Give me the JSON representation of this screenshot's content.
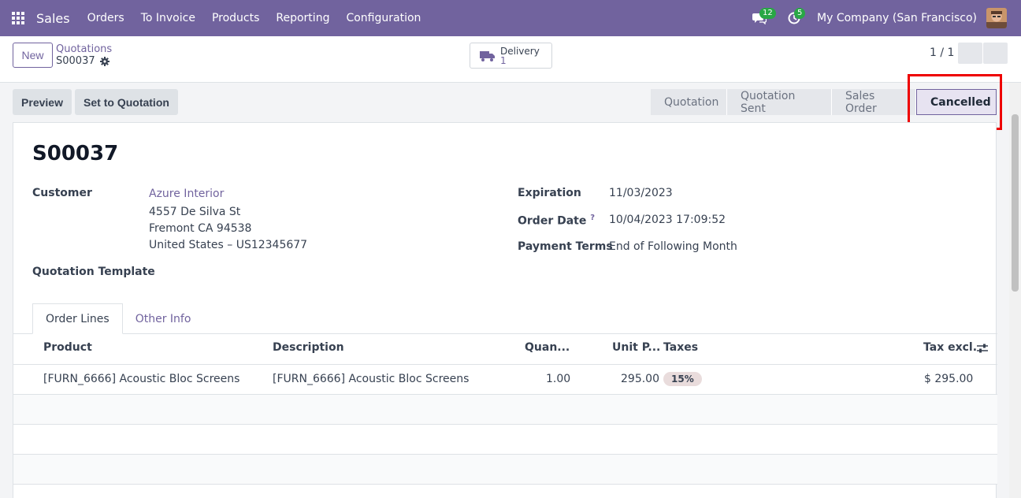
{
  "navbar": {
    "app_name": "Sales",
    "menu": [
      "Orders",
      "To Invoice",
      "Products",
      "Reporting",
      "Configuration"
    ],
    "messages_count": "12",
    "activities_count": "5",
    "company": "My Company (San Francisco)",
    "accent": "#71639e"
  },
  "control": {
    "new_label": "New",
    "breadcrumb_parent": "Quotations",
    "breadcrumb_current": "S00037",
    "delivery_label": "Delivery",
    "delivery_count": "1",
    "pager": "1 / 1"
  },
  "actions": {
    "preview": "Preview",
    "set_to_quotation": "Set to Quotation"
  },
  "statusbar": {
    "stages": [
      "Quotation",
      "Quotation Sent",
      "Sales Order",
      "Cancelled"
    ],
    "current": "Cancelled"
  },
  "record": {
    "title": "S00037",
    "customer_label": "Customer",
    "customer_name": "Azure Interior",
    "address_line1": "4557 De Silva St",
    "address_line2": "Fremont CA 94538",
    "address_line3": "United States – US12345677",
    "template_label": "Quotation Template",
    "expiration_label": "Expiration",
    "expiration_value": "11/03/2023",
    "order_date_label": "Order Date",
    "order_date_help": "?",
    "order_date_value": "10/04/2023 17:09:52",
    "payment_terms_label": "Payment Terms",
    "payment_terms_value": "End of Following Month"
  },
  "tabs": [
    "Order Lines",
    "Other Info"
  ],
  "table": {
    "headers": {
      "product": "Product",
      "description": "Description",
      "quantity": "Quan...",
      "unit_price": "Unit P...",
      "taxes": "Taxes",
      "tax_excl": "Tax excl."
    },
    "rows": [
      {
        "product": "[FURN_6666] Acoustic Bloc Screens",
        "description": "[FURN_6666] Acoustic Bloc Screens",
        "quantity": "1.00",
        "unit_price": "295.00",
        "tax": "15%",
        "subtotal": "$ 295.00"
      }
    ]
  }
}
